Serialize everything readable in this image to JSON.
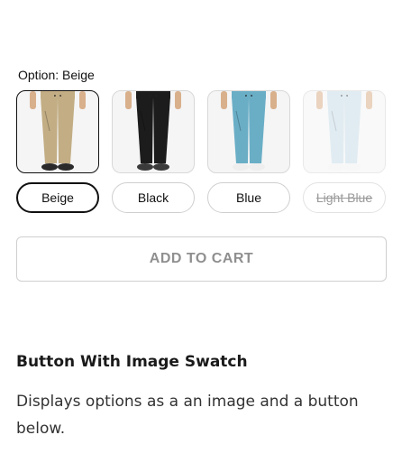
{
  "option": {
    "label": "Option: Beige"
  },
  "swatches": [
    {
      "label": "Beige",
      "selected": true,
      "disabled": false,
      "pants_color": "#c2ad84",
      "shoe_color": "#2a2a2a"
    },
    {
      "label": "Black",
      "selected": false,
      "disabled": false,
      "pants_color": "#1c1c1c",
      "shoe_color": "#3a3a3a"
    },
    {
      "label": "Blue",
      "selected": false,
      "disabled": false,
      "pants_color": "#6aaec6",
      "shoe_color": "#eeeeee"
    },
    {
      "label": "Light Blue",
      "selected": false,
      "disabled": true,
      "pants_color": "#c9dde8",
      "shoe_color": "#f2f2f2"
    }
  ],
  "cart": {
    "add_label": "ADD TO CART"
  },
  "info": {
    "title": "Button With Image Swatch",
    "description": "Displays options as a an image and a button below."
  }
}
